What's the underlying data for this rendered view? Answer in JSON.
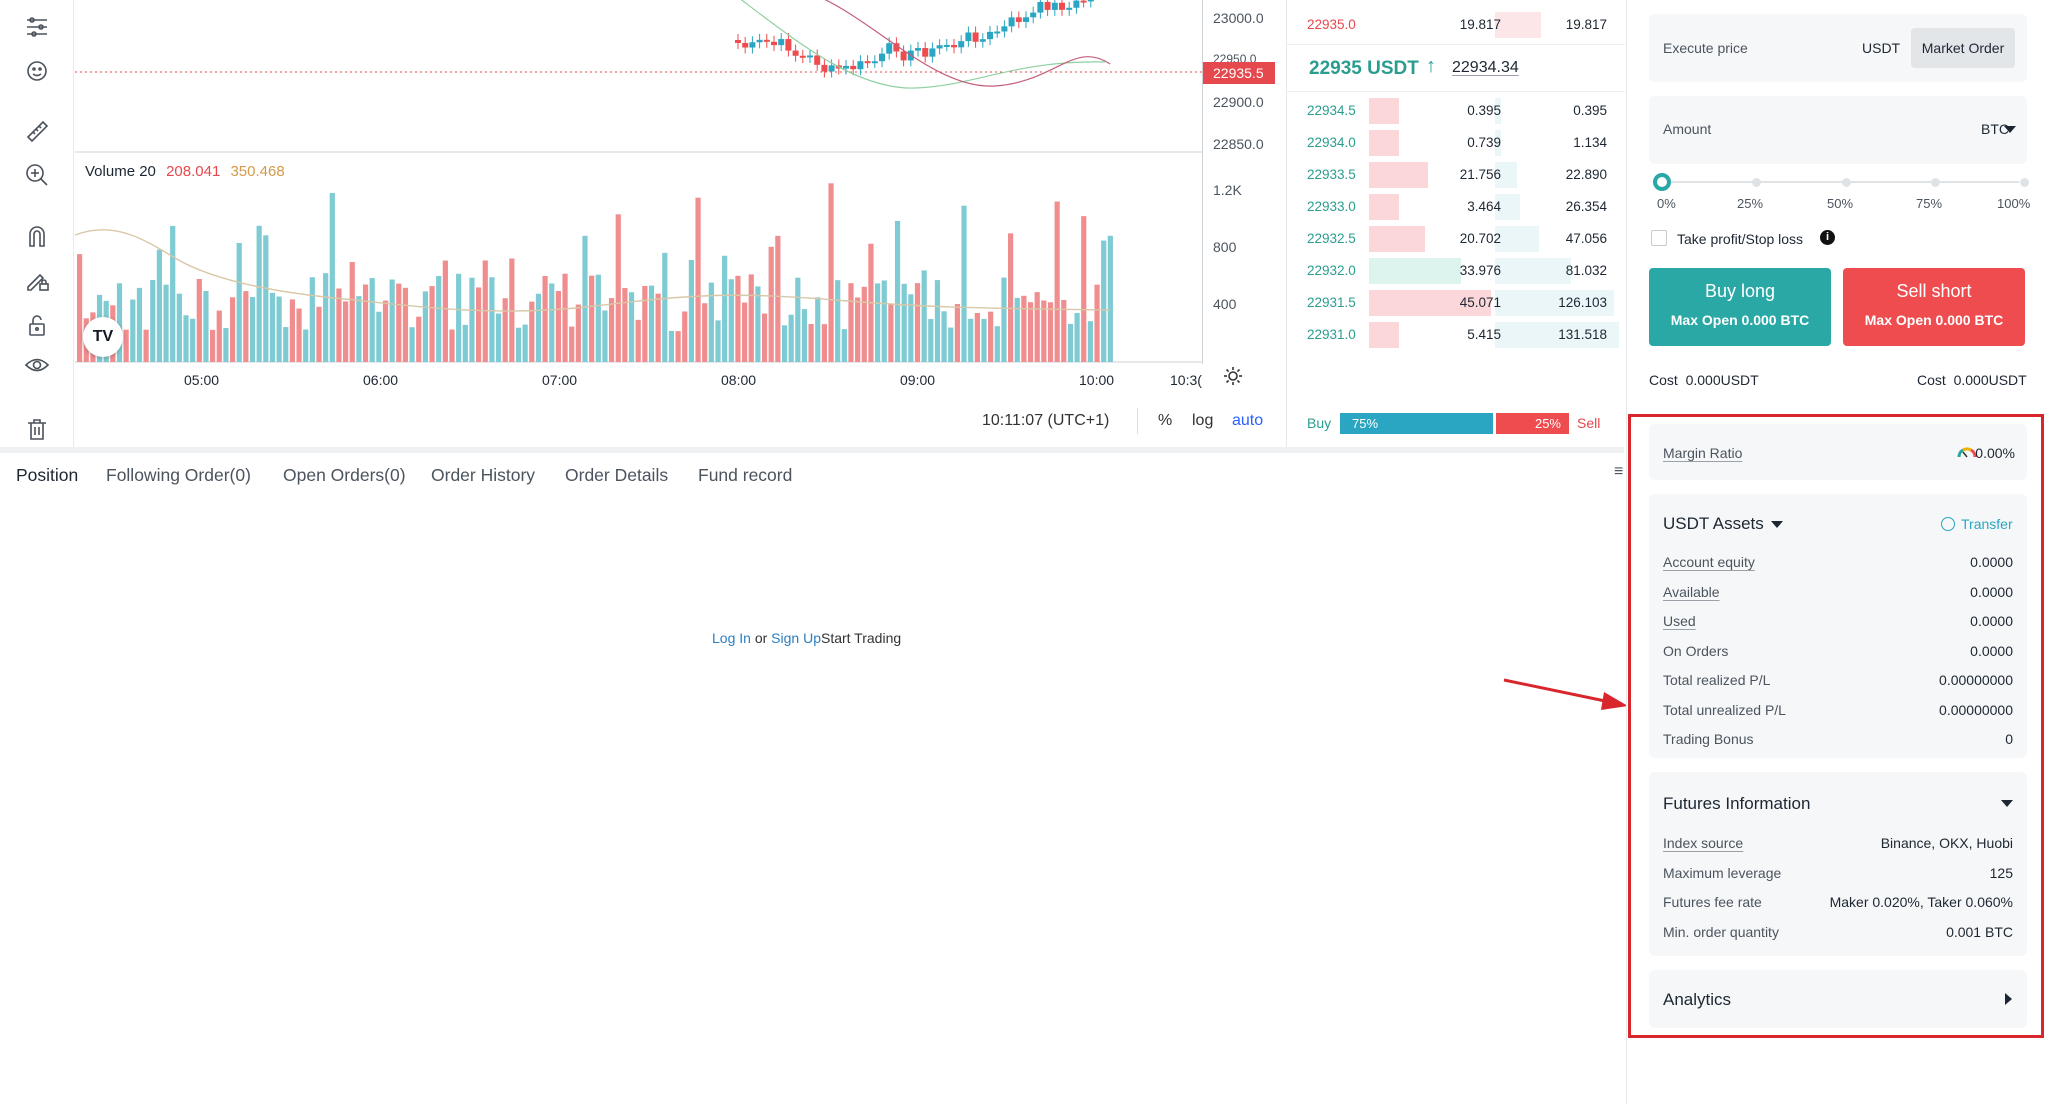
{
  "chart": {
    "price_ticks": [
      "23000.0",
      "22950.0",
      "22900.0",
      "22850.0"
    ],
    "current_price_tag": "22935.5",
    "volume_label": "Volume 20",
    "volume_value_1": "208.041",
    "volume_value_2": "350.468",
    "volume_ticks": [
      "1.2K",
      "800",
      "400"
    ],
    "time_ticks": [
      "05:00",
      "06:00",
      "07:00",
      "08:00",
      "09:00",
      "10:00",
      "10:3("
    ],
    "clock": "10:11:07 (UTC+1)",
    "scale_percent": "%",
    "scale_log": "log",
    "scale_auto": "auto",
    "logo": "TV",
    "colors": {
      "up": "#7fcbd3",
      "down": "#f08d8f",
      "ma": "#d8c8a8"
    }
  },
  "orderbook": {
    "top_row": {
      "price": "22935.0",
      "size": "19.817",
      "total": "19.817"
    },
    "last_price": "22935 USDT",
    "mark_price": "22934.34",
    "rows": [
      {
        "price": "22934.5",
        "size": "0.395",
        "total": "0.395"
      },
      {
        "price": "22934.0",
        "size": "0.739",
        "total": "1.134"
      },
      {
        "price": "22933.5",
        "size": "21.756",
        "total": "22.890"
      },
      {
        "price": "22933.0",
        "size": "3.464",
        "total": "26.354"
      },
      {
        "price": "22932.5",
        "size": "20.702",
        "total": "47.056"
      },
      {
        "price": "22932.0",
        "size": "33.976",
        "total": "81.032"
      },
      {
        "price": "22931.5",
        "size": "45.071",
        "total": "126.103"
      },
      {
        "price": "22931.0",
        "size": "5.415",
        "total": "131.518"
      }
    ],
    "buy_label": "Buy",
    "buy_pct": "75%",
    "sell_pct": "25%",
    "sell_label": "Sell",
    "buy_ratio": 0.75,
    "colors": {
      "green": "#2a9d8f",
      "red": "#e5484d",
      "buy_bar": "#2aa6c2",
      "sell_bar": "#ee4c4e"
    }
  },
  "tabs": [
    "Position",
    "Following Order(0)",
    "Open Orders(0)",
    "Order History",
    "Order Details",
    "Fund record"
  ],
  "empty": {
    "login": "Log In",
    "or": "or",
    "signup": "Sign Up",
    "start": "Start Trading"
  },
  "trade": {
    "execute_label": "Execute price",
    "execute_unit": "USDT",
    "execute_type": "Market Order",
    "amount_label": "Amount",
    "amount_unit": "BTC",
    "slider_marks": [
      "0%",
      "25%",
      "50%",
      "75%",
      "100%"
    ],
    "slider_value": 0,
    "tpsl": "Take profit/Stop loss",
    "buy_label": "Buy long",
    "buy_sub": "Max Open 0.000 BTC",
    "sell_label": "Sell short",
    "sell_sub": "Max Open 0.000 BTC",
    "cost_buy": "Cost  0.000USDT",
    "cost_sell": "Cost  0.000USDT"
  },
  "margin": {
    "label": "Margin Ratio",
    "value": "0.00%"
  },
  "assets": {
    "title": "USDT Assets",
    "transfer": "Transfer",
    "rows": [
      {
        "label": "Account equity",
        "value": "0.0000"
      },
      {
        "label": "Available",
        "value": "0.0000"
      },
      {
        "label": "Used",
        "value": "0.0000"
      },
      {
        "label": "On Orders",
        "value": "0.0000"
      },
      {
        "label": "Total realized P/L",
        "value": "0.00000000"
      },
      {
        "label": "Total unrealized P/L",
        "value": "0.00000000"
      },
      {
        "label": "Trading Bonus",
        "value": "0"
      }
    ]
  },
  "futures": {
    "title": "Futures Information",
    "rows": [
      {
        "label": "Index source",
        "value": "Binance, OKX, Huobi"
      },
      {
        "label": "Maximum leverage",
        "value": "125"
      },
      {
        "label": "Futures fee rate",
        "value": "Maker 0.020%, Taker 0.060%"
      },
      {
        "label": "Min. order quantity",
        "value": "0.001 BTC"
      }
    ]
  },
  "analytics": {
    "title": "Analytics"
  },
  "annotation_color": "#d9262c"
}
